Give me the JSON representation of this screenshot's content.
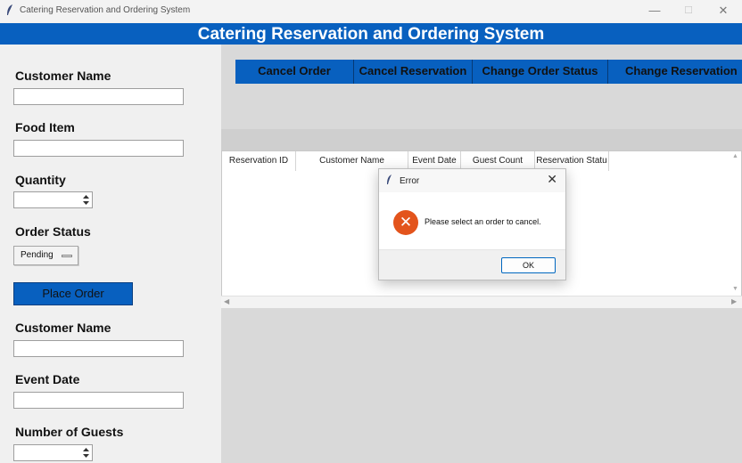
{
  "window": {
    "title": "Catering Reservation and Ordering System",
    "controls": {
      "minimize": "—",
      "maximize": "☐",
      "close": "✕"
    }
  },
  "banner": {
    "title": "Catering Reservation and Ordering System"
  },
  "order_form": {
    "customer_name_label": "Customer Name",
    "customer_name_value": "",
    "food_item_label": "Food Item",
    "food_item_value": "",
    "quantity_label": "Quantity",
    "quantity_value": "",
    "order_status_label": "Order Status",
    "order_status_value": "Pending",
    "place_order_label": "Place Order"
  },
  "reservation_form": {
    "customer_name_label": "Customer Name",
    "customer_name_value": "",
    "event_date_label": "Event Date",
    "event_date_value": "",
    "guests_label": "Number of Guests",
    "guests_value": ""
  },
  "toolbar": {
    "cancel_order": "Cancel Order",
    "cancel_reservation": "Cancel Reservation",
    "change_order_status": "Change Order Status",
    "change_reservation": "Change Reservation"
  },
  "reservations_table": {
    "columns": [
      "Reservation ID",
      "Customer Name",
      "Event Date",
      "Guest Count",
      "Reservation Statu"
    ],
    "rows": []
  },
  "error_dialog": {
    "title": "Error",
    "message": "Please select an order to cancel.",
    "ok_label": "OK"
  },
  "colors": {
    "accent": "#0860bf",
    "error_icon": "#e3541c"
  }
}
